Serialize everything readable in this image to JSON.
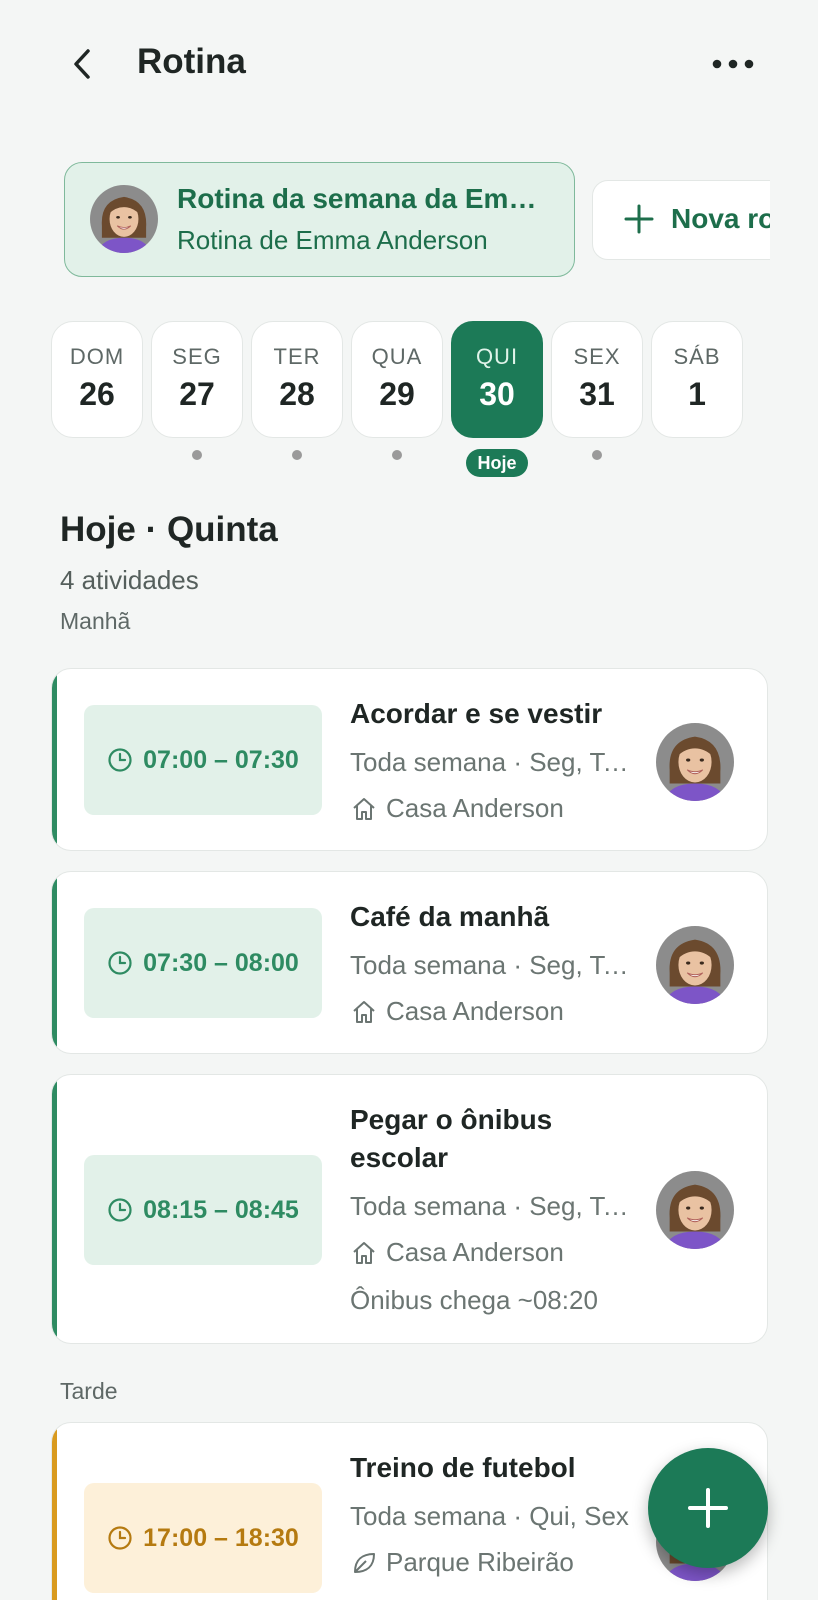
{
  "header": {
    "title": "Rotina",
    "back_icon": "chevron-left-icon",
    "more_icon": "more-horizontal-icon"
  },
  "routines": {
    "selected": {
      "title": "Rotina da semana da Emma Anderson",
      "subtitle": "Rotina de Emma Anderson"
    },
    "new_button_label": "Nova rotina"
  },
  "days": [
    {
      "name": "DOM",
      "num": "26",
      "has_dot": false
    },
    {
      "name": "SEG",
      "num": "27",
      "has_dot": true
    },
    {
      "name": "TER",
      "num": "28",
      "has_dot": true
    },
    {
      "name": "QUA",
      "num": "29",
      "has_dot": true
    },
    {
      "name": "QUI",
      "num": "30",
      "active": true
    },
    {
      "name": "SEX",
      "num": "31",
      "has_dot": true
    },
    {
      "name": "SÁB",
      "num": "1",
      "has_dot": false
    }
  ],
  "today_badge": "Hoje",
  "day_heading": "Hoje · Quinta",
  "activity_count": "4 atividades",
  "sections": {
    "morning": "Manhã",
    "afternoon": "Tarde"
  },
  "activities": [
    {
      "time": "07:00 – 07:30",
      "title": "Acordar e se vestir",
      "recurrence": "Toda semana · Seg, Ter, Qua, Qui, Sex",
      "place": "Casa Anderson",
      "place_icon": "home-icon"
    },
    {
      "time": "07:30 – 08:00",
      "title": "Café da manhã",
      "recurrence": "Toda semana · Seg, Ter, Qua, Qui, Sex",
      "place": "Casa Anderson",
      "place_icon": "home-icon"
    },
    {
      "time": "08:15 – 08:45",
      "title": "Pegar o ônibus escolar",
      "recurrence": "Toda semana · Seg, Ter, Qua, Qui, Sex",
      "place": "Casa Anderson",
      "place_icon": "home-icon",
      "note": "Ônibus chega ~08:20"
    },
    {
      "time": "17:00 – 18:30",
      "title": "Treino de futebol",
      "recurrence": "Toda semana · Qui, Sex",
      "place": "Parque Ribeirão",
      "place_icon": "leaf-icon"
    }
  ],
  "colors": {
    "primary": "#1c7a57",
    "morning_accent": "#2e8b62",
    "morning_bg": "#e2f1e9",
    "afternoon_accent": "#d99a1e",
    "afternoon_bg": "#fdf0d9",
    "afternoon_text": "#b57a10"
  },
  "fab_icon": "plus-icon"
}
